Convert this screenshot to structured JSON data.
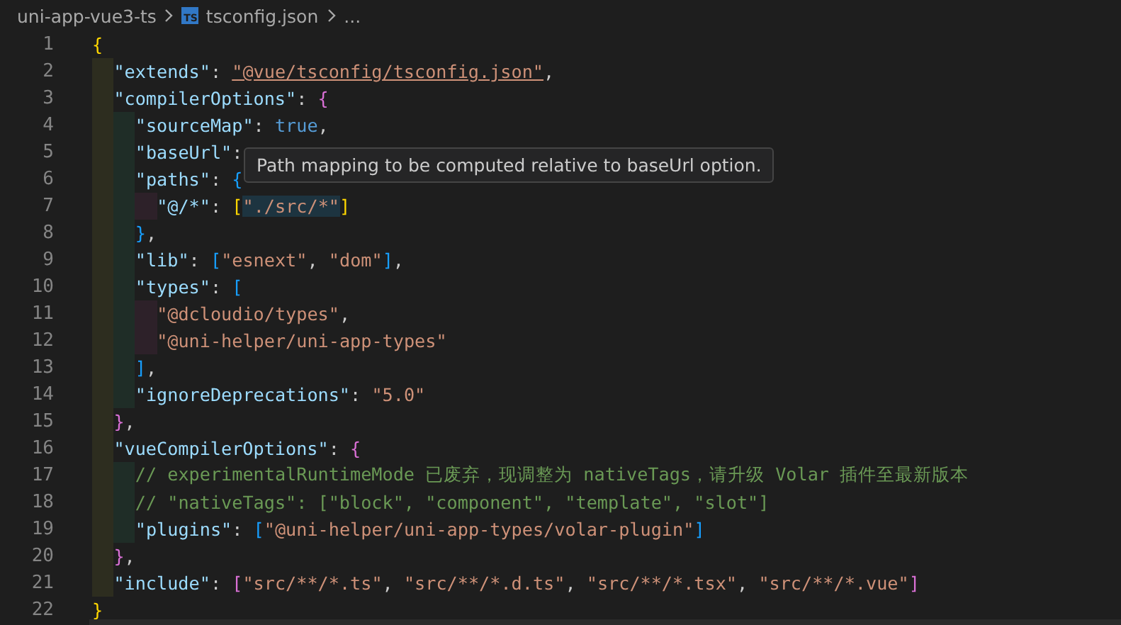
{
  "breadcrumb": {
    "folder": "uni-app-vue3-ts",
    "file_icon": "TS",
    "file": "tsconfig.json",
    "more": "..."
  },
  "tooltip": {
    "text": "Path mapping to be computed relative to baseUrl option."
  },
  "lines": [
    {
      "number": "1",
      "tokens": [
        {
          "kind": "bracket",
          "text": "{",
          "color": "#ffd700"
        }
      ]
    },
    {
      "number": "2",
      "guides": [
        {
          "color": "#2d2d1f"
        }
      ],
      "tokens": [
        {
          "kind": "key",
          "text": "\"extends\""
        },
        {
          "kind": "punct",
          "text": ": "
        },
        {
          "kind": "link",
          "text": "\"@vue/tsconfig/tsconfig.json\""
        },
        {
          "kind": "punct",
          "text": ","
        }
      ]
    },
    {
      "number": "3",
      "guides": [
        {
          "color": "#2d2d1f"
        }
      ],
      "tokens": [
        {
          "kind": "key",
          "text": "\"compilerOptions\""
        },
        {
          "kind": "punct",
          "text": ": "
        },
        {
          "kind": "bracket",
          "text": "{",
          "color": "#da70d6"
        }
      ]
    },
    {
      "number": "4",
      "guides": [
        {
          "color": "#2d2d1f"
        },
        {
          "color": "#1f2d27"
        }
      ],
      "tokens": [
        {
          "kind": "key",
          "text": "\"sourceMap\""
        },
        {
          "kind": "punct",
          "text": ": "
        },
        {
          "kind": "bool",
          "text": "true"
        },
        {
          "kind": "punct",
          "text": ","
        }
      ]
    },
    {
      "number": "5",
      "guides": [
        {
          "color": "#2d2d1f"
        },
        {
          "color": "#1f2d27"
        }
      ],
      "tokens": [
        {
          "kind": "key",
          "text": "\"baseUrl\""
        },
        {
          "kind": "punct",
          "text": ":"
        }
      ]
    },
    {
      "number": "6",
      "guides": [
        {
          "color": "#2d2d1f"
        },
        {
          "color": "#1f2d27"
        }
      ],
      "tokens": [
        {
          "kind": "key",
          "text": "\"paths\""
        },
        {
          "kind": "punct",
          "text": ": "
        },
        {
          "kind": "bracket",
          "text": "{",
          "color": "#179fff"
        }
      ]
    },
    {
      "number": "7",
      "guides": [
        {
          "color": "#2d2d1f"
        },
        {
          "color": "#1f2d27"
        },
        {
          "color": "#2d2129"
        }
      ],
      "tokens": [
        {
          "kind": "key",
          "text": "\"@/*\""
        },
        {
          "kind": "punct",
          "text": ": "
        },
        {
          "kind": "bracket",
          "text": "[",
          "color": "#ffd700"
        },
        {
          "kind": "highlight",
          "text": "\"./src/*\""
        },
        {
          "kind": "bracket",
          "text": "]",
          "color": "#ffd700"
        }
      ]
    },
    {
      "number": "8",
      "guides": [
        {
          "color": "#2d2d1f"
        },
        {
          "color": "#1f2d27"
        }
      ],
      "tokens": [
        {
          "kind": "bracket",
          "text": "}",
          "color": "#179fff"
        },
        {
          "kind": "punct",
          "text": ","
        }
      ]
    },
    {
      "number": "9",
      "guides": [
        {
          "color": "#2d2d1f"
        },
        {
          "color": "#1f2d27"
        }
      ],
      "tokens": [
        {
          "kind": "key",
          "text": "\"lib\""
        },
        {
          "kind": "punct",
          "text": ": "
        },
        {
          "kind": "bracket",
          "text": "[",
          "color": "#179fff"
        },
        {
          "kind": "string",
          "text": "\"esnext\""
        },
        {
          "kind": "punct",
          "text": ", "
        },
        {
          "kind": "string",
          "text": "\"dom\""
        },
        {
          "kind": "bracket",
          "text": "]",
          "color": "#179fff"
        },
        {
          "kind": "punct",
          "text": ","
        }
      ]
    },
    {
      "number": "10",
      "guides": [
        {
          "color": "#2d2d1f"
        },
        {
          "color": "#1f2d27"
        }
      ],
      "tokens": [
        {
          "kind": "key",
          "text": "\"types\""
        },
        {
          "kind": "punct",
          "text": ": "
        },
        {
          "kind": "bracket",
          "text": "[",
          "color": "#179fff"
        }
      ]
    },
    {
      "number": "11",
      "guides": [
        {
          "color": "#2d2d1f"
        },
        {
          "color": "#1f2d27"
        },
        {
          "color": "#2d2129"
        }
      ],
      "tokens": [
        {
          "kind": "string",
          "text": "\"@dcloudio/types\""
        },
        {
          "kind": "punct",
          "text": ","
        }
      ]
    },
    {
      "number": "12",
      "guides": [
        {
          "color": "#2d2d1f"
        },
        {
          "color": "#1f2d27"
        },
        {
          "color": "#2d2129"
        }
      ],
      "tokens": [
        {
          "kind": "string",
          "text": "\"@uni-helper/uni-app-types\""
        }
      ]
    },
    {
      "number": "13",
      "guides": [
        {
          "color": "#2d2d1f"
        },
        {
          "color": "#1f2d27"
        }
      ],
      "tokens": [
        {
          "kind": "bracket",
          "text": "]",
          "color": "#179fff"
        },
        {
          "kind": "punct",
          "text": ","
        }
      ]
    },
    {
      "number": "14",
      "guides": [
        {
          "color": "#2d2d1f"
        },
        {
          "color": "#1f2d27"
        }
      ],
      "tokens": [
        {
          "kind": "key",
          "text": "\"ignoreDeprecations\""
        },
        {
          "kind": "punct",
          "text": ": "
        },
        {
          "kind": "string",
          "text": "\"5.0\""
        }
      ]
    },
    {
      "number": "15",
      "guides": [
        {
          "color": "#2d2d1f"
        }
      ],
      "tokens": [
        {
          "kind": "bracket",
          "text": "}",
          "color": "#da70d6"
        },
        {
          "kind": "punct",
          "text": ","
        }
      ]
    },
    {
      "number": "16",
      "guides": [
        {
          "color": "#2d2d1f"
        }
      ],
      "tokens": [
        {
          "kind": "key",
          "text": "\"vueCompilerOptions\""
        },
        {
          "kind": "punct",
          "text": ": "
        },
        {
          "kind": "bracket",
          "text": "{",
          "color": "#da70d6"
        }
      ]
    },
    {
      "number": "17",
      "guides": [
        {
          "color": "#2d2d1f"
        },
        {
          "color": "#1f2d27"
        }
      ],
      "tokens": [
        {
          "kind": "comment",
          "text": "// experimentalRuntimeMode 已废弃，现调整为 nativeTags，请升级 Volar 插件至最新版本"
        }
      ]
    },
    {
      "number": "18",
      "guides": [
        {
          "color": "#2d2d1f"
        },
        {
          "color": "#1f2d27"
        }
      ],
      "tokens": [
        {
          "kind": "comment",
          "text": "// \"nativeTags\": [\"block\", \"component\", \"template\", \"slot\"]"
        }
      ]
    },
    {
      "number": "19",
      "guides": [
        {
          "color": "#2d2d1f"
        },
        {
          "color": "#1f2d27"
        }
      ],
      "tokens": [
        {
          "kind": "key",
          "text": "\"plugins\""
        },
        {
          "kind": "punct",
          "text": ": "
        },
        {
          "kind": "bracket",
          "text": "[",
          "color": "#179fff"
        },
        {
          "kind": "string",
          "text": "\"@uni-helper/uni-app-types/volar-plugin\""
        },
        {
          "kind": "bracket",
          "text": "]",
          "color": "#179fff"
        }
      ]
    },
    {
      "number": "20",
      "guides": [
        {
          "color": "#2d2d1f"
        }
      ],
      "tokens": [
        {
          "kind": "bracket",
          "text": "}",
          "color": "#da70d6"
        },
        {
          "kind": "punct",
          "text": ","
        }
      ]
    },
    {
      "number": "21",
      "guides": [
        {
          "color": "#2d2d1f"
        }
      ],
      "tokens": [
        {
          "kind": "key",
          "text": "\"include\""
        },
        {
          "kind": "punct",
          "text": ": "
        },
        {
          "kind": "bracket",
          "text": "[",
          "color": "#da70d6"
        },
        {
          "kind": "string",
          "text": "\"src/**/*.ts\""
        },
        {
          "kind": "punct",
          "text": ", "
        },
        {
          "kind": "string",
          "text": "\"src/**/*.d.ts\""
        },
        {
          "kind": "punct",
          "text": ", "
        },
        {
          "kind": "string",
          "text": "\"src/**/*.tsx\""
        },
        {
          "kind": "punct",
          "text": ", "
        },
        {
          "kind": "string",
          "text": "\"src/**/*.vue\""
        },
        {
          "kind": "bracket",
          "text": "]",
          "color": "#da70d6"
        }
      ]
    },
    {
      "number": "22",
      "tokens": [
        {
          "kind": "bracket",
          "text": "}",
          "color": "#ffd700"
        }
      ]
    }
  ]
}
